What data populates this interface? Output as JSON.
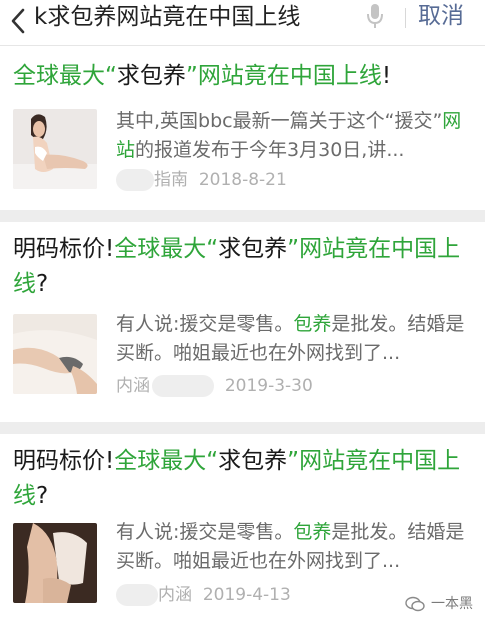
{
  "search": {
    "query": "k求包养网站竟在中国上线",
    "cancel_label": "取消"
  },
  "results": [
    {
      "title_parts": [
        {
          "text": "全球最大“",
          "hl": true
        },
        {
          "text": "求包养",
          "hl": false
        },
        {
          "text": "”网站竟在中国上线",
          "hl": true
        },
        {
          "text": "!",
          "hl": false
        }
      ],
      "snippet_parts": [
        {
          "text": "其中,英国bbc最新一篇关于这个“援交”",
          "hl": false
        },
        {
          "text": "网站",
          "hl": true
        },
        {
          "text": "的报道发布于今年3月30日,讲...",
          "hl": false
        }
      ],
      "source": "指南",
      "date": "2018-8-21"
    },
    {
      "title_parts": [
        {
          "text": "明码标价!",
          "hl": false
        },
        {
          "text": "全球最大“",
          "hl": true
        },
        {
          "text": "求包养",
          "hl": false
        },
        {
          "text": "”网站竟在中国上线",
          "hl": true
        },
        {
          "text": "?",
          "hl": false
        }
      ],
      "snippet_parts": [
        {
          "text": "有人说:援交是零售。",
          "hl": false
        },
        {
          "text": "包养",
          "hl": true
        },
        {
          "text": "是批发。结婚是买断。啪姐最近也在外网找到了...",
          "hl": false
        }
      ],
      "source": "内涵",
      "date": "2019-3-30"
    },
    {
      "title_parts": [
        {
          "text": "明码标价!",
          "hl": false
        },
        {
          "text": "全球最大“",
          "hl": true
        },
        {
          "text": "求包养",
          "hl": false
        },
        {
          "text": "”网站竟在中国上线",
          "hl": true
        },
        {
          "text": "?",
          "hl": false
        }
      ],
      "snippet_parts": [
        {
          "text": "有人说:援交是零售。",
          "hl": false
        },
        {
          "text": "包养",
          "hl": true
        },
        {
          "text": "是批发。结婚是买断。啪姐最近也在外网找到了...",
          "hl": false
        }
      ],
      "source": "内涵",
      "date": "2019-4-13"
    }
  ],
  "watermark": "一本黑",
  "colors": {
    "highlight": "#2fa53a",
    "link": "#576b95",
    "meta": "#b0b0b0",
    "snippet": "#6b6b6b",
    "separator": "#ededed"
  },
  "icons": {
    "back": "chevron-left-icon",
    "mic": "microphone-icon",
    "watermark": "wechat-icon"
  }
}
